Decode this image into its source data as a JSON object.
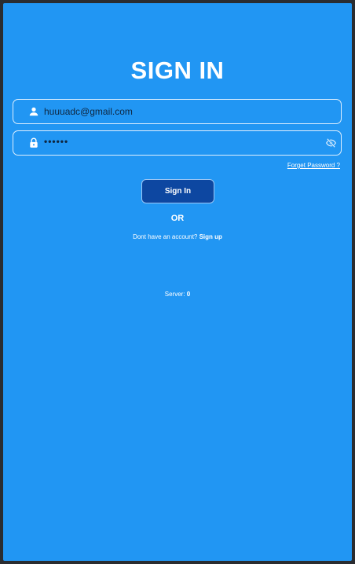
{
  "screen": {
    "title": "SIGN IN"
  },
  "email_field": {
    "value": "huuuadc@gmail.com",
    "icon": "person-icon"
  },
  "password_field": {
    "value": "••••••",
    "icon": "lock-icon",
    "toggle_icon": "eye-off-icon"
  },
  "forgot_password": {
    "label": "Forget Password ?"
  },
  "signin_button": {
    "label": "Sign In"
  },
  "divider": {
    "label": "OR"
  },
  "signup": {
    "prompt": "Dont have an account?",
    "link_label": "Sign up"
  },
  "server": {
    "label": "Server:",
    "value": "0"
  },
  "colors": {
    "background": "#2196f3",
    "button": "#0d47a1",
    "text": "#ffffff"
  }
}
